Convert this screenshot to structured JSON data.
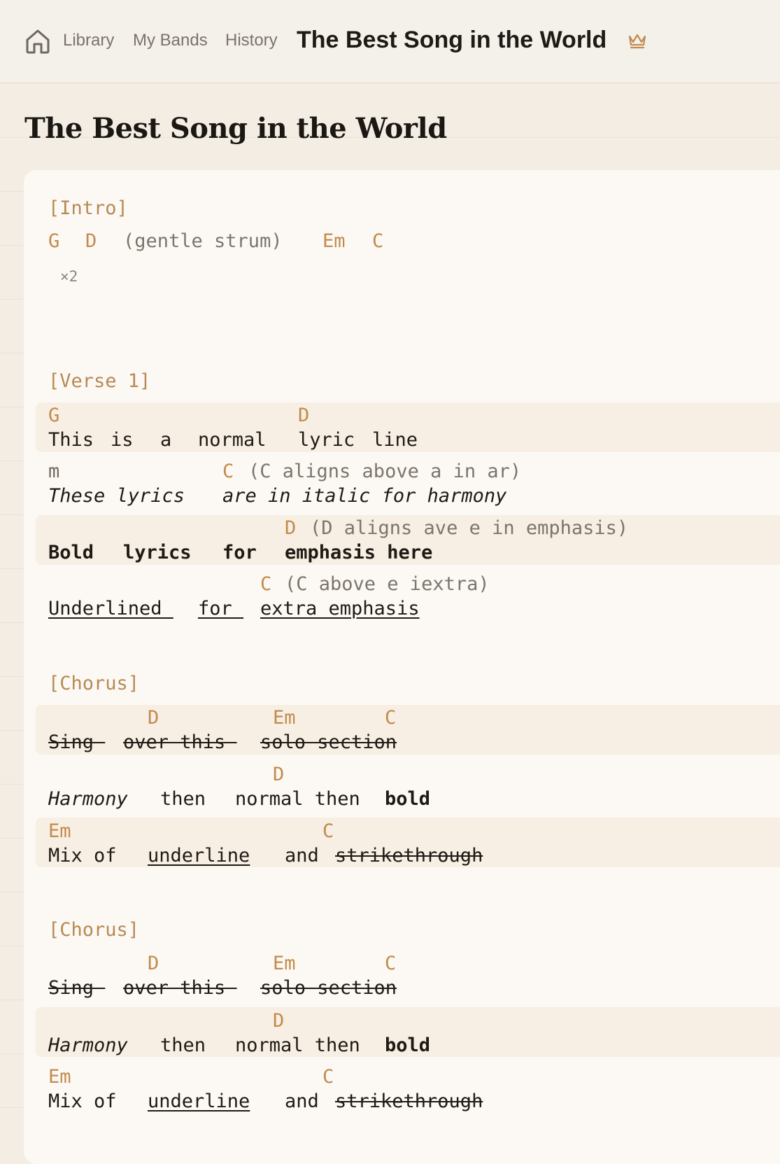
{
  "nav": {
    "library": "Library",
    "my_bands": "My Bands",
    "history": "History",
    "current_song": "The Best Song in the World"
  },
  "song_title": "The Best Song in the World",
  "sections": {
    "intro": {
      "header": "[Intro]",
      "chords": [
        "G",
        "D",
        "Em",
        "C"
      ],
      "note": "(gentle strum)",
      "repeat": "×2"
    },
    "verse1": {
      "header": "[Verse 1]",
      "line1": {
        "chords": [
          "G",
          "D"
        ],
        "lyrics": [
          "This",
          "is",
          "a",
          "normal",
          "lyric",
          "line"
        ]
      },
      "line2": {
        "prefix": "m",
        "chord": "C",
        "note": "(C aligns above a in ar)",
        "lyrics": [
          "These lyrics",
          "are in italic for harmony"
        ]
      },
      "line3": {
        "chord": "D",
        "note": "(D aligns ave e in emphasis)",
        "lyrics": [
          "Bold",
          "lyrics",
          "for",
          "emphasis here"
        ]
      },
      "line4": {
        "chord": "C",
        "note": "(C above e iextra)",
        "lyrics": [
          "Underlined ",
          "for ",
          "extra emphasis"
        ]
      }
    },
    "chorus": {
      "header": "[Chorus]",
      "line1": {
        "chords": [
          "D",
          "Em",
          "C"
        ],
        "lyrics": [
          "Sing ",
          "over this ",
          "solo section"
        ]
      },
      "line2": {
        "chords": [
          "D"
        ],
        "lyrics": [
          "Harmony",
          "then",
          "normal then",
          "bold"
        ]
      },
      "line3": {
        "chords": [
          "Em",
          "C"
        ],
        "lyrics": [
          "Mix of",
          "underline",
          "and",
          "strikethrough"
        ]
      }
    }
  },
  "colors": {
    "chord": "#c38a4d",
    "section": "#b78a55",
    "background": "#f3ede3",
    "card": "#fcf9f4",
    "line_highlight": "#f7efe3"
  }
}
